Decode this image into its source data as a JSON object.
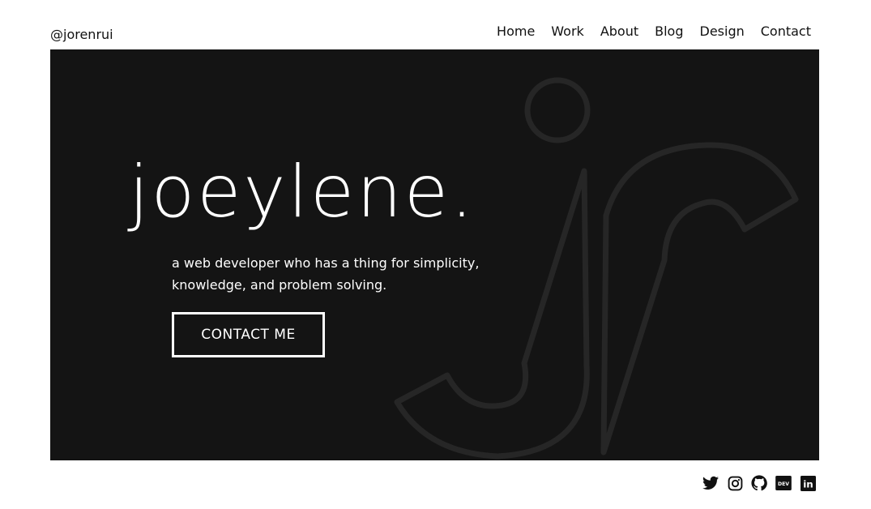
{
  "header": {
    "handle": "@jorenrui",
    "nav": [
      "Home",
      "Work",
      "About",
      "Blog",
      "Design",
      "Contact"
    ]
  },
  "hero": {
    "title": "joeylene.",
    "tagline_line1": "a web developer who has a thing for simplicity,",
    "tagline_line2": "knowledge, and problem solving.",
    "cta_label": "CONTACT ME",
    "background_color": "#141414",
    "mark_color": "#262626",
    "text_color": "#ffffff"
  },
  "social": {
    "icons": [
      "twitter-icon",
      "instagram-icon",
      "github-icon",
      "dev-icon",
      "linkedin-icon"
    ],
    "dev_label": "DEV",
    "linkedin_label": "in"
  }
}
